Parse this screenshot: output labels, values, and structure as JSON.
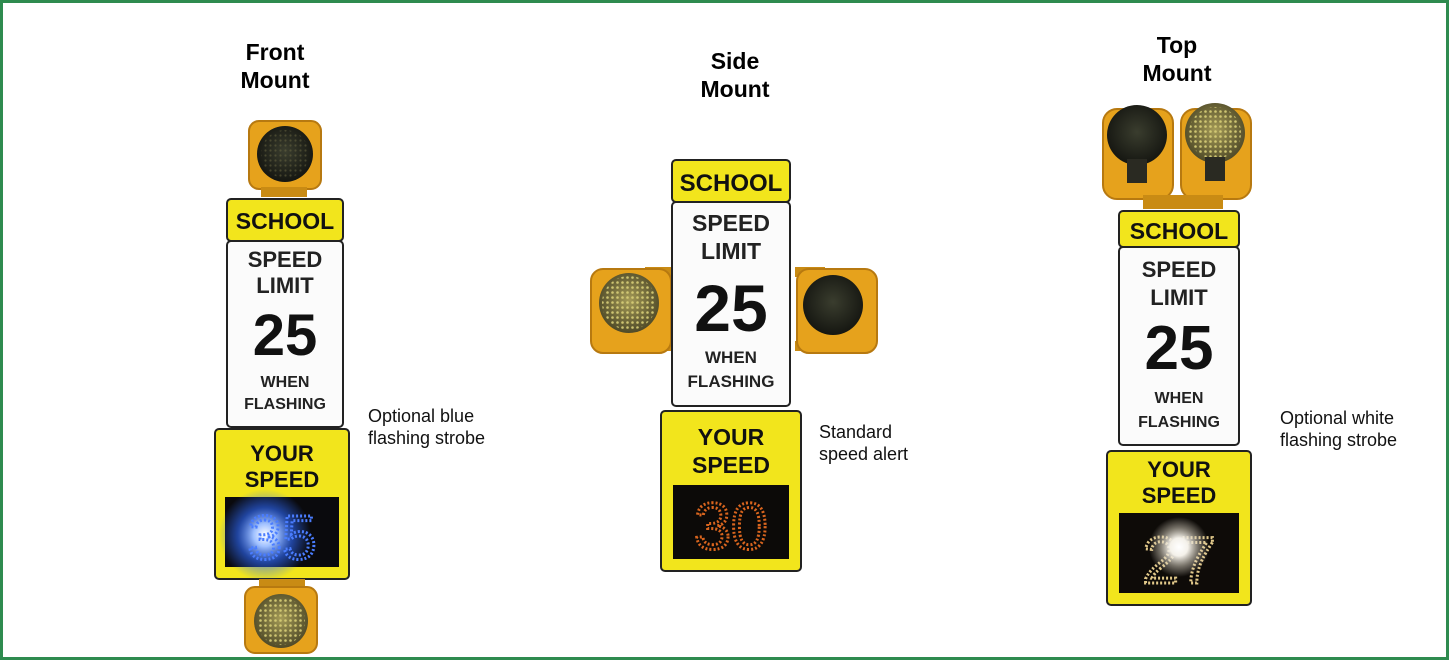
{
  "colors": {
    "border": "#2e8b4f",
    "sign_yellow": "#f2e51c",
    "housing_amber": "#e6a21c",
    "led_amber": "#d9651e",
    "led_blue": "#2f6bff"
  },
  "icons": [
    "beacon-icon",
    "led-digits-icon",
    "strobe-flash-icon"
  ],
  "mounts": [
    {
      "title_line1": "Front",
      "title_line2": "Mount",
      "caption_line1": "Optional blue",
      "caption_line2": "flashing strobe",
      "sign": {
        "school": "SCHOOL",
        "speed": "SPEED",
        "limit": "LIMIT",
        "number": "25",
        "when": "WHEN",
        "flashing": "FLASHING"
      },
      "display": {
        "line1": "YOUR",
        "line2": "SPEED",
        "digits": "35"
      }
    },
    {
      "title_line1": "Side",
      "title_line2": "Mount",
      "caption_line1": "Standard",
      "caption_line2": "speed alert",
      "sign": {
        "school": "SCHOOL",
        "speed": "SPEED",
        "limit": "LIMIT",
        "number": "25",
        "when": "WHEN",
        "flashing": "FLASHING"
      },
      "display": {
        "line1": "YOUR",
        "line2": "SPEED",
        "digits": "30"
      }
    },
    {
      "title_line1": "Top",
      "title_line2": "Mount",
      "caption_line1": "Optional white",
      "caption_line2": "flashing strobe",
      "sign": {
        "school": "SCHOOL",
        "speed": "SPEED",
        "limit": "LIMIT",
        "number": "25",
        "when": "WHEN",
        "flashing": "FLASHING"
      },
      "display": {
        "line1": "YOUR",
        "line2": "SPEED",
        "digits": "27"
      }
    }
  ]
}
